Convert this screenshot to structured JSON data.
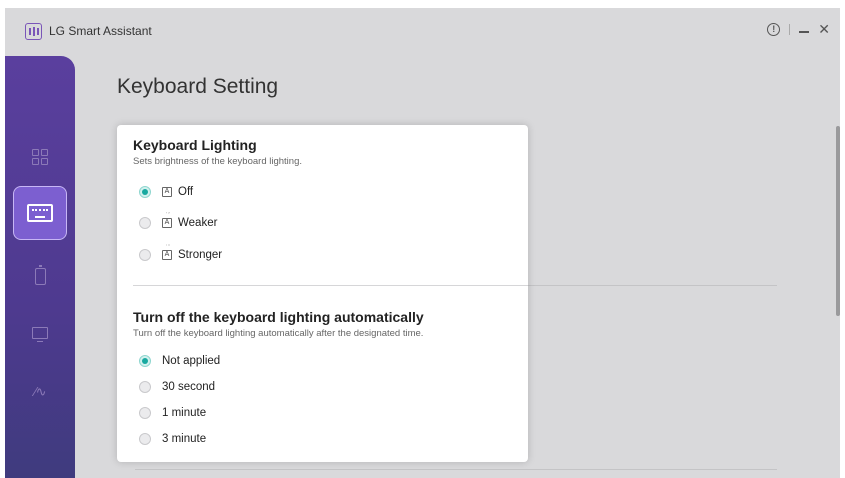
{
  "app": {
    "title": "LG Smart Assistant",
    "logo_icon": "lg-smart-assistant-logo-icon"
  },
  "window_controls": [
    "info-icon",
    "minimize-icon",
    "close-icon"
  ],
  "sidebar": {
    "items": [
      {
        "name": "dashboard",
        "icon": "dashboard-icon",
        "active": false
      },
      {
        "name": "keyboard",
        "icon": "keyboard-icon",
        "active": true
      },
      {
        "name": "battery",
        "icon": "battery-icon",
        "active": false
      },
      {
        "name": "display",
        "icon": "monitor-icon",
        "active": false
      },
      {
        "name": "sound",
        "icon": "sound-wave-icon",
        "active": false
      }
    ],
    "accent": "#7c5fd0"
  },
  "page": {
    "title": "Keyboard Setting"
  },
  "keyboard_lighting": {
    "title": "Keyboard Lighting",
    "description": "Sets brightness of the keyboard lighting.",
    "options": [
      {
        "label": "Off",
        "selected": true,
        "icon": "key-light-off-icon"
      },
      {
        "label": "Weaker",
        "selected": false,
        "icon": "key-light-weak-icon"
      },
      {
        "label": "Stronger",
        "selected": false,
        "icon": "key-light-strong-icon"
      }
    ]
  },
  "auto_off": {
    "title": "Turn off the keyboard lighting automatically",
    "description": "Turn off the keyboard lighting automatically after the designated time.",
    "options": [
      {
        "label": "Not applied",
        "selected": true
      },
      {
        "label": "30 second",
        "selected": false
      },
      {
        "label": "1 minute",
        "selected": false
      },
      {
        "label": "3 minute",
        "selected": false
      }
    ]
  },
  "colors": {
    "radio_selected": "#18a9a0",
    "sidebar_top": "#5a3f9e",
    "sidebar_bottom": "#3f3b7e"
  }
}
